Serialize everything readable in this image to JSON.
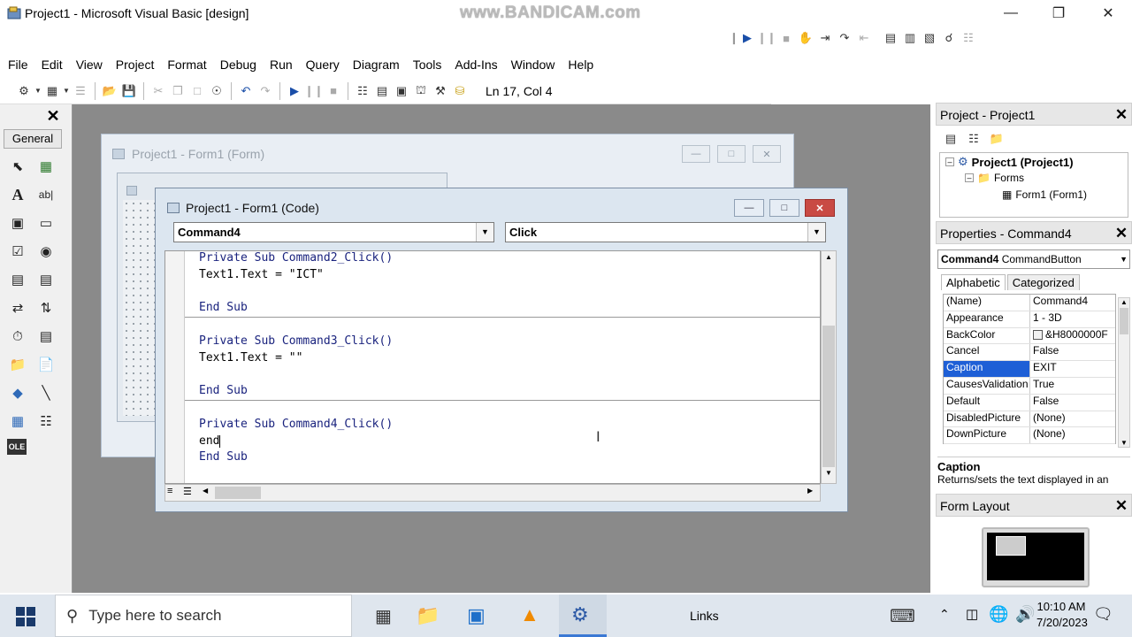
{
  "window": {
    "title": "Project1 - Microsoft Visual Basic [design]",
    "watermark": "www.BANDICAM.com"
  },
  "menu": [
    "File",
    "Edit",
    "View",
    "Project",
    "Format",
    "Debug",
    "Run",
    "Query",
    "Diagram",
    "Tools",
    "Add-Ins",
    "Window",
    "Help"
  ],
  "toolbar": {
    "position": "Ln 17, Col 4"
  },
  "toolbox": {
    "tab_label": "General"
  },
  "form_designer": {
    "title": "Project1 - Form1 (Form)"
  },
  "code_window": {
    "title": "Project1 - Form1 (Code)",
    "object_combo": "Command4",
    "procedure_combo": "Click",
    "lines": [
      "Private Sub Command2_Click()",
      "Text1.Text = \"ICT\"",
      "",
      "End Sub",
      "",
      "Private Sub Command3_Click()",
      "Text1.Text = \"\"",
      "",
      "End Sub",
      "",
      "Private Sub Command4_Click()",
      "end",
      "End Sub"
    ]
  },
  "project_panel": {
    "title": "Project - Project1",
    "tree": {
      "root": "Project1 (Project1)",
      "folder": "Forms",
      "item": "Form1 (Form1)"
    }
  },
  "properties_panel": {
    "title": "Properties - Command4",
    "object": "Command4",
    "object_type": "CommandButton",
    "tabs": [
      "Alphabetic",
      "Categorized"
    ],
    "rows": [
      {
        "name": "(Name)",
        "value": "Command4"
      },
      {
        "name": "Appearance",
        "value": "1 - 3D"
      },
      {
        "name": "BackColor",
        "value": "&H8000000F"
      },
      {
        "name": "Cancel",
        "value": "False"
      },
      {
        "name": "Caption",
        "value": "EXIT"
      },
      {
        "name": "CausesValidation",
        "value": "True"
      },
      {
        "name": "Default",
        "value": "False"
      },
      {
        "name": "DisabledPicture",
        "value": "(None)"
      },
      {
        "name": "DownPicture",
        "value": "(None)"
      }
    ],
    "description_title": "Caption",
    "description_text": "Returns/sets the text displayed in an"
  },
  "layout_panel": {
    "title": "Form Layout"
  },
  "taskbar": {
    "search_placeholder": "Type here to search",
    "links_label": "Links",
    "time": "10:10 AM",
    "date": "7/20/2023"
  }
}
